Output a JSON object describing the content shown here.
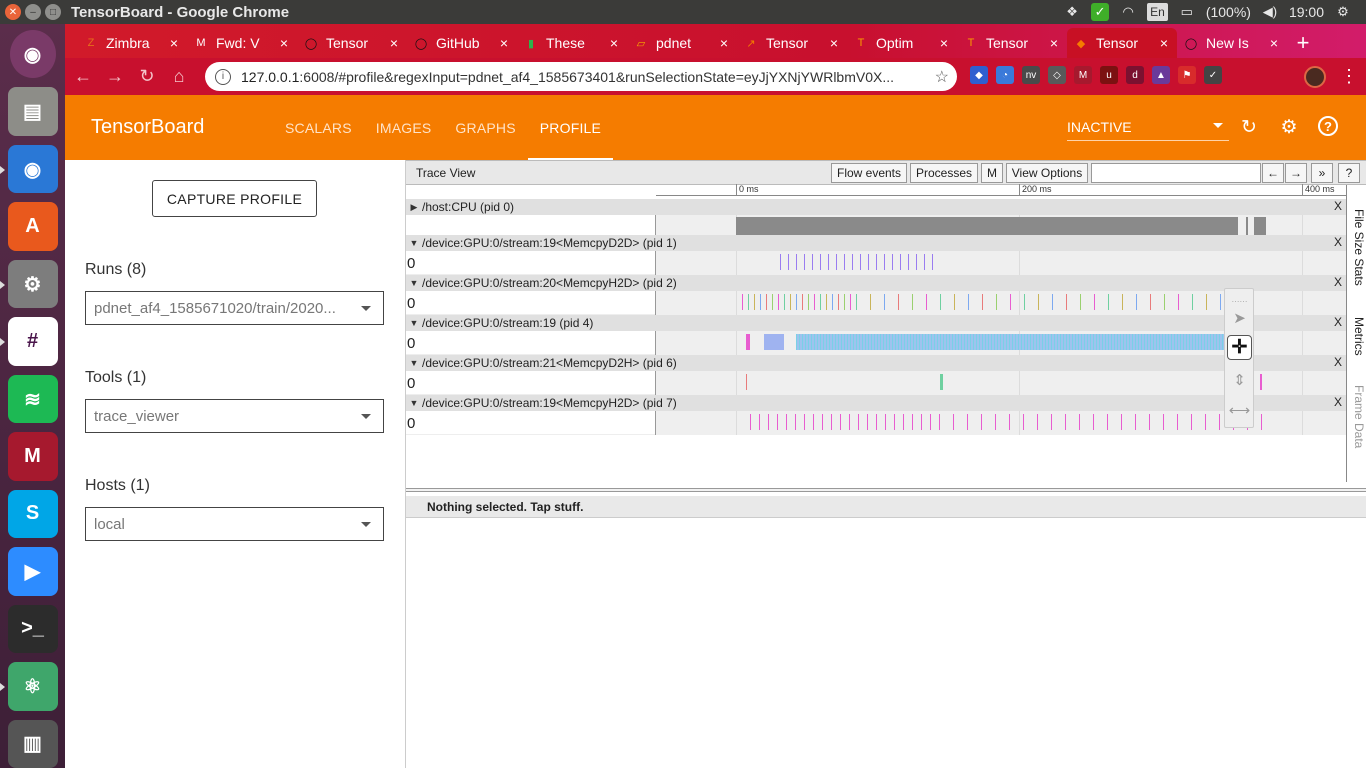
{
  "os": {
    "window_title": "TensorBoard - Google Chrome",
    "tray": {
      "dropbox_icon": "dropbox-icon",
      "update_icon": "check-icon",
      "wifi_icon": "wifi-icon",
      "language": "En",
      "battery": "(100%)",
      "volume_icon": "volume-icon",
      "time": "19:00",
      "settings_icon": "gear-icon"
    },
    "launcher": [
      {
        "name": "ubuntu-dash",
        "glyph": "◉",
        "color": "#7a3a68"
      },
      {
        "name": "files",
        "glyph": "▤",
        "color": "#8d8d88"
      },
      {
        "name": "chrome",
        "glyph": "◉",
        "color": "#2a78d6"
      },
      {
        "name": "software-center",
        "glyph": "A",
        "color": "#e9591d"
      },
      {
        "name": "system-settings",
        "glyph": "⚙",
        "color": "#7d7d7d"
      },
      {
        "name": "slack",
        "glyph": "#",
        "color": "#ffffff"
      },
      {
        "name": "spotify",
        "glyph": "≋",
        "color": "#1db954"
      },
      {
        "name": "mendeley",
        "glyph": "M",
        "color": "#a6192e"
      },
      {
        "name": "skype",
        "glyph": "S",
        "color": "#00a6e7"
      },
      {
        "name": "zoom",
        "glyph": "▶",
        "color": "#2d8cff"
      },
      {
        "name": "terminal",
        "glyph": ">_",
        "color": "#2c2c2c"
      },
      {
        "name": "atom",
        "glyph": "⚛",
        "color": "#3fa66b"
      },
      {
        "name": "trash",
        "glyph": "▥",
        "color": "#555555"
      }
    ]
  },
  "browser": {
    "tabs": [
      {
        "title": "Zimbra",
        "fav": "Z",
        "fav_color": "#e56f1a"
      },
      {
        "title": "Fwd: V",
        "fav": "M",
        "fav_color": "#ffffff"
      },
      {
        "title": "Tensor",
        "fav": "◯",
        "fav_color": "#111111"
      },
      {
        "title": "GitHub",
        "fav": "◯",
        "fav_color": "#111111"
      },
      {
        "title": "These",
        "fav": "▮",
        "fav_color": "#2eb34b"
      },
      {
        "title": "pdnet",
        "fav": "▱",
        "fav_color": "#f6a700"
      },
      {
        "title": "Tensor",
        "fav": "↗",
        "fav_color": "#f57c00"
      },
      {
        "title": "Optim",
        "fav": "T",
        "fav_color": "#f79d00"
      },
      {
        "title": "Tensor",
        "fav": "T",
        "fav_color": "#f79d00"
      },
      {
        "title": "Tensor",
        "fav": "◆",
        "fav_color": "#f57c00"
      },
      {
        "title": "New Is",
        "fav": "◯",
        "fav_color": "#111111"
      }
    ],
    "new_tab": "+",
    "url_host": "127.0.0.1",
    "url_rest": ":6008/#profile&regexInput=pdnet_af4_1585673401&runSelectionState=eyJjYXNjYWRlbmV0X...",
    "back_icon": "←",
    "forward_icon": "→",
    "reload_icon": "↻",
    "home_icon": "⌂",
    "star_icon": "☆",
    "menu_icon": "⋮",
    "extensions": [
      {
        "name": "ext-shield",
        "glyph": "◆",
        "color": "#2f5fd0"
      },
      {
        "name": "ext-compass",
        "glyph": "◔",
        "color": "#3b7ad9"
      },
      {
        "name": "ext-nvidia",
        "glyph": "nv",
        "color": "#4a4a4a"
      },
      {
        "name": "ext-bulb",
        "glyph": "◇",
        "color": "#5a5a5a"
      },
      {
        "name": "ext-mendeley",
        "glyph": "M",
        "color": "#a6192e"
      },
      {
        "name": "ext-ublock",
        "glyph": "u",
        "color": "#7b1111"
      },
      {
        "name": "ext-d",
        "glyph": "d",
        "color": "#7b1130"
      },
      {
        "name": "ext-tag",
        "glyph": "▲",
        "color": "#6a3a9a"
      },
      {
        "name": "ext-flag",
        "glyph": "⚑",
        "color": "#d82b2b"
      },
      {
        "name": "ext-check",
        "glyph": "✓",
        "color": "#444444"
      }
    ]
  },
  "tensorboard": {
    "brand": "TensorBoard",
    "nav": [
      {
        "label": "SCALARS",
        "active": false
      },
      {
        "label": "IMAGES",
        "active": false
      },
      {
        "label": "GRAPHS",
        "active": false
      },
      {
        "label": "PROFILE",
        "active": true
      }
    ],
    "status": "INACTIVE",
    "refresh_icon": "↻",
    "settings_icon": "⚙",
    "help_icon": "?",
    "accent": "#f57c00"
  },
  "sidebar": {
    "capture_button": "CAPTURE PROFILE",
    "runs_label": "Runs (8)",
    "runs_value": "pdnet_af4_1585671020/train/2020...",
    "tools_label": "Tools (1)",
    "tools_value": "trace_viewer",
    "hosts_label": "Hosts (1)",
    "hosts_value": "local"
  },
  "trace": {
    "title": "Trace View",
    "buttons": {
      "flow": "Flow events",
      "processes": "Processes",
      "m": "M",
      "view_options": "View Options",
      "prev": "←",
      "next": "→",
      "more": "»",
      "help": "?"
    },
    "ruler": [
      "0 ms",
      "200 ms",
      "400 ms"
    ],
    "side_tabs": [
      "File Size Stats",
      "Metrics",
      "Frame Data"
    ],
    "close_label": "X",
    "processes": [
      {
        "name": "/host:CPU (pid 0)",
        "expanded": false,
        "value": ""
      },
      {
        "name": "/device:GPU:0/stream:19<MemcpyD2D> (pid 1)",
        "expanded": true,
        "value": "0"
      },
      {
        "name": "/device:GPU:0/stream:20<MemcpyH2D> (pid 2)",
        "expanded": true,
        "value": "0"
      },
      {
        "name": "/device:GPU:0/stream:19 (pid 4)",
        "expanded": true,
        "value": "0"
      },
      {
        "name": "/device:GPU:0/stream:21<MemcpyD2H> (pid 6)",
        "expanded": true,
        "value": "0"
      },
      {
        "name": "/device:GPU:0/stream:19<MemcpyH2D> (pid 7)",
        "expanded": true,
        "value": "0"
      }
    ],
    "mouse_tools": [
      "pointer-tool",
      "pan-tool",
      "zoom-tool",
      "timing-tool"
    ],
    "analysis_text": "Nothing selected. Tap stuff."
  }
}
